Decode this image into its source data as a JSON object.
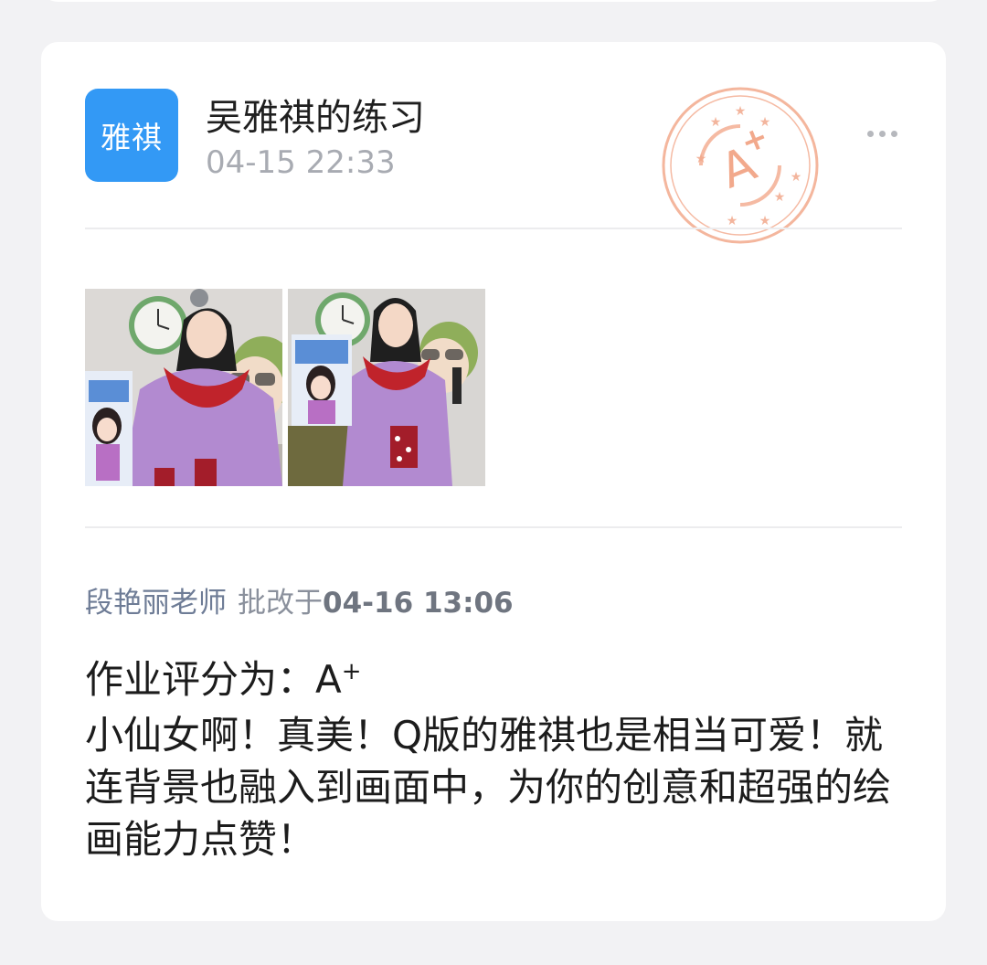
{
  "post": {
    "avatar_text": "雅祺",
    "title": "吴雅祺的练习",
    "time": "04-15 22:33",
    "stamp_grade": "A",
    "stamp_grade_sup": "+",
    "more_icon": "more-horizontal-icon"
  },
  "images": [
    {
      "alt": "练习作品照片1",
      "icon": "photo"
    },
    {
      "alt": "练习作品照片2",
      "icon": "photo"
    }
  ],
  "review": {
    "teacher": "段艳丽老师",
    "verb": "批改于",
    "date": "04-16 13:06"
  },
  "feedback": {
    "grade_label": "作业评分为：",
    "grade_value": "A",
    "grade_sup": "+",
    "comment": "小仙女啊！真美！Q版的雅祺也是相当可爱！就连背景也融入到画面中，为你的创意和超强的绘画能力点赞！"
  },
  "colors": {
    "background": "#f2f2f4",
    "card": "#ffffff",
    "avatar": "#3399f5",
    "stamp": "#f2a98c",
    "teacher_name": "#6e7c96",
    "muted_text": "#a8abb2"
  }
}
